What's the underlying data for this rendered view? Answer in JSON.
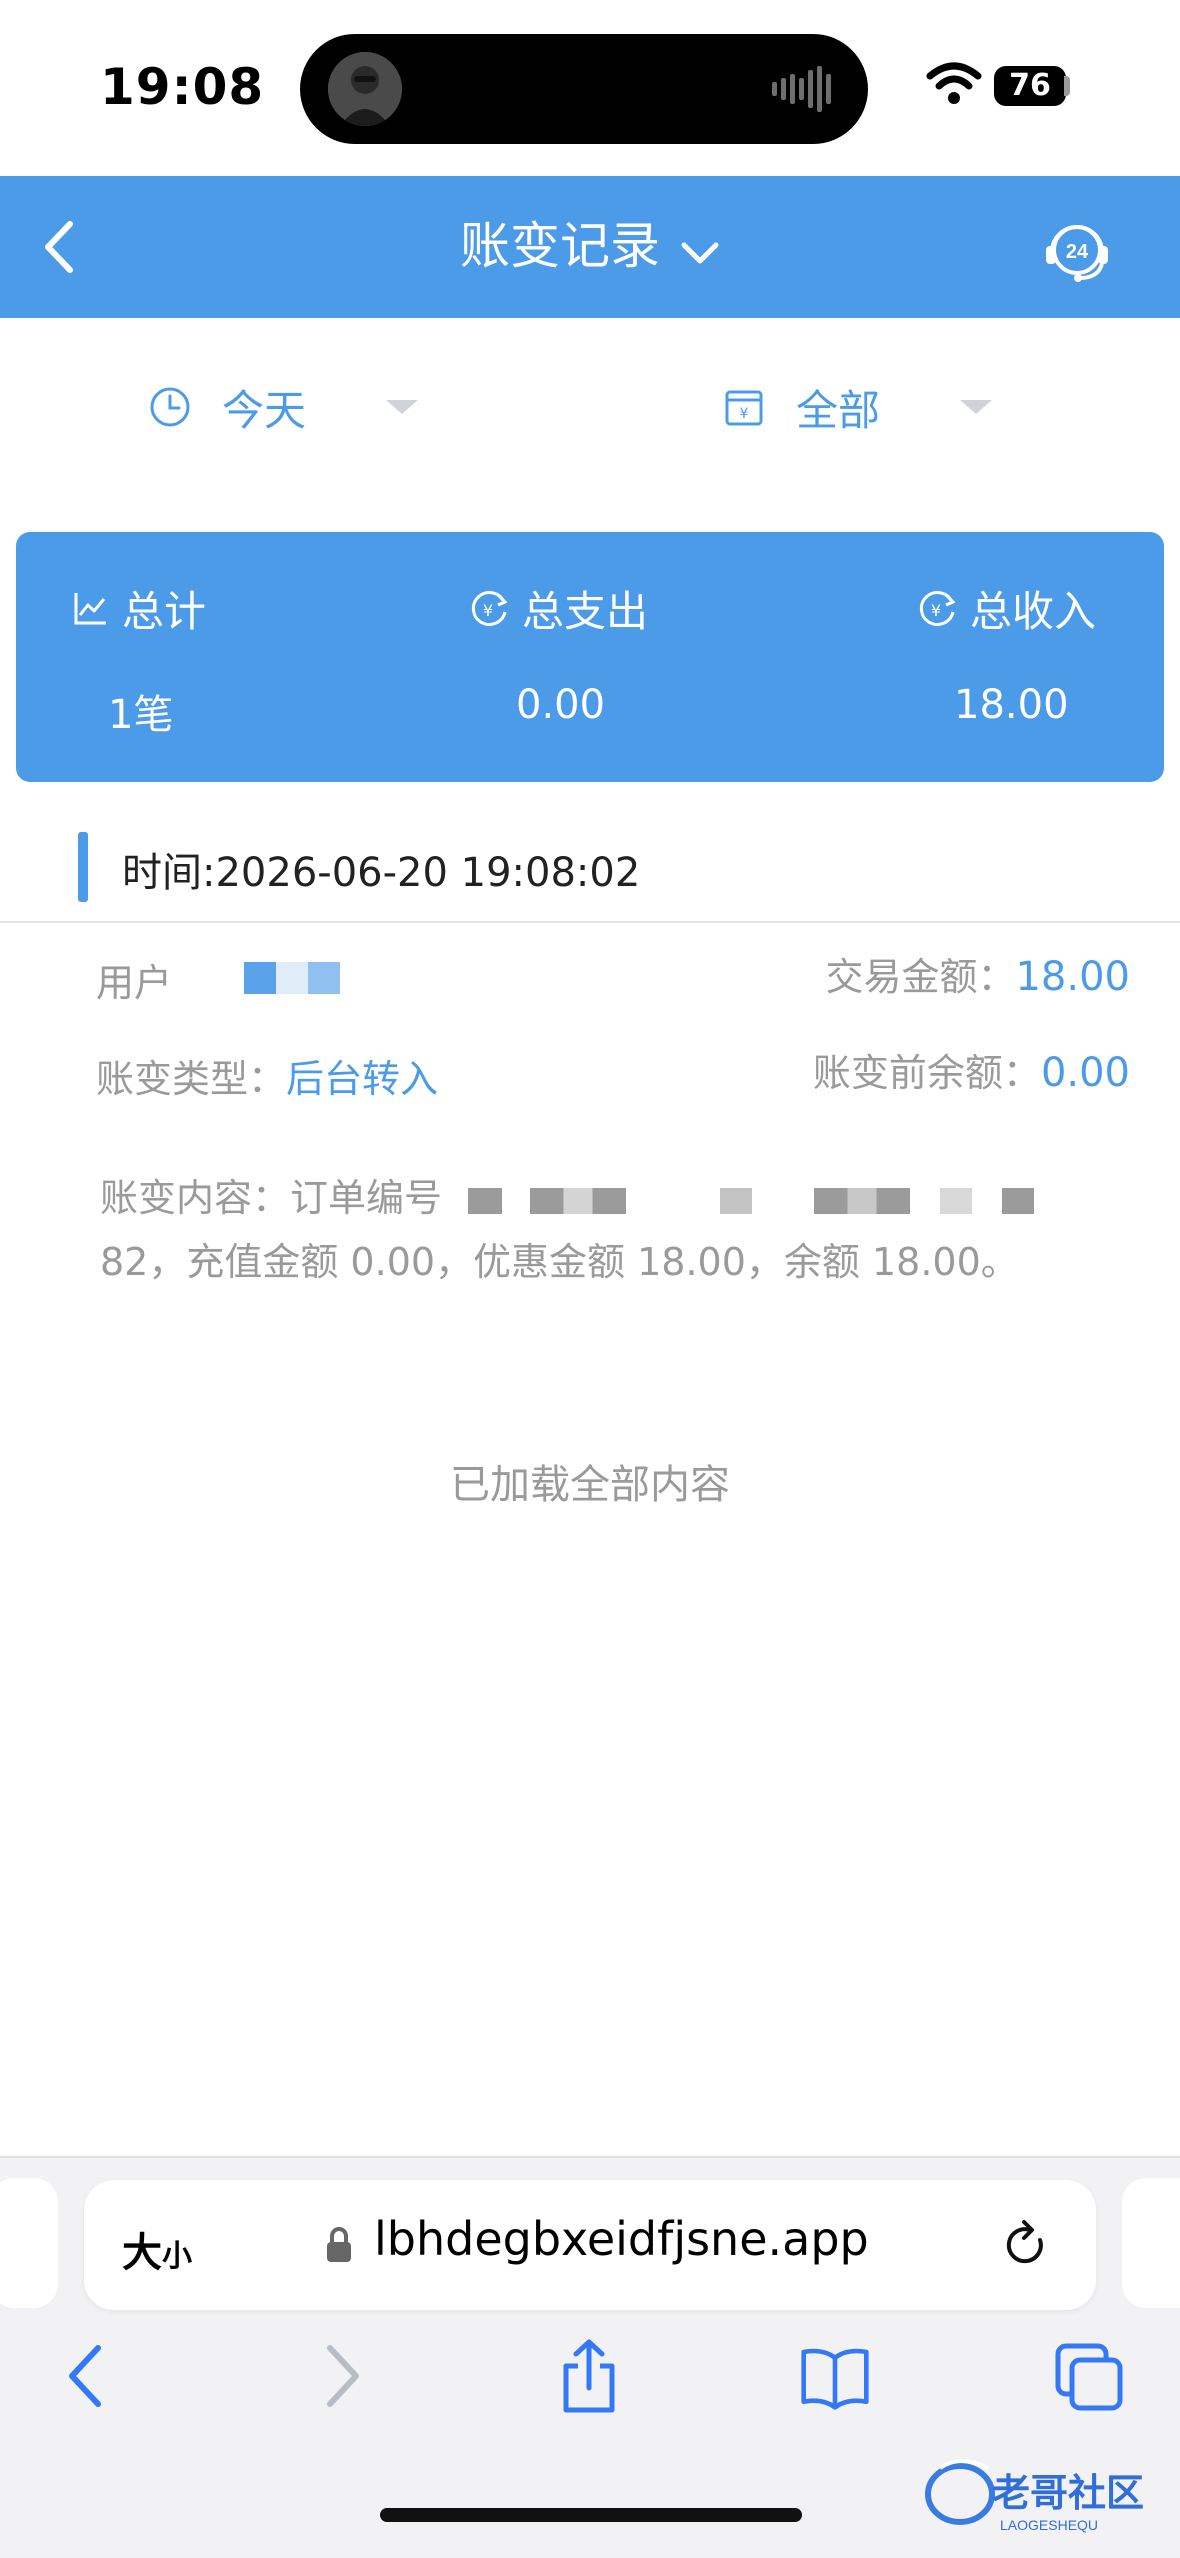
{
  "status": {
    "time": "19:08",
    "battery": "76"
  },
  "header": {
    "title": "账变记录"
  },
  "filters": {
    "date": "今天",
    "type": "全部"
  },
  "summary": {
    "count_label": "总计",
    "count_value": "1笔",
    "out_label": "总支出",
    "out_value": "0.00",
    "in_label": "总收入",
    "in_value": "18.00"
  },
  "record": {
    "time": "时间:2026-06-20 19:08:02",
    "user_label": "用户",
    "amount_label": "交易金额：",
    "amount_value": "18.00",
    "type_label": "账变类型：",
    "type_value": "后台转入",
    "pre_label": "账变前余额：",
    "pre_value": "0.00",
    "content_prefix": "账变内容：订单编号",
    "content_rest": "82，充值金额 0.00，优惠金额 18.00，余额 18.00。"
  },
  "footer_text": "已加载全部内容",
  "browser": {
    "text_size": "大",
    "text_size_small": "小",
    "url": "lbhdegbxeidfjsne.app"
  },
  "watermark": {
    "text": "老哥社区",
    "subtext": "LAOGESHEQU"
  },
  "colors": {
    "accent": "#4c9be8",
    "muted": "#9a9a9a"
  }
}
